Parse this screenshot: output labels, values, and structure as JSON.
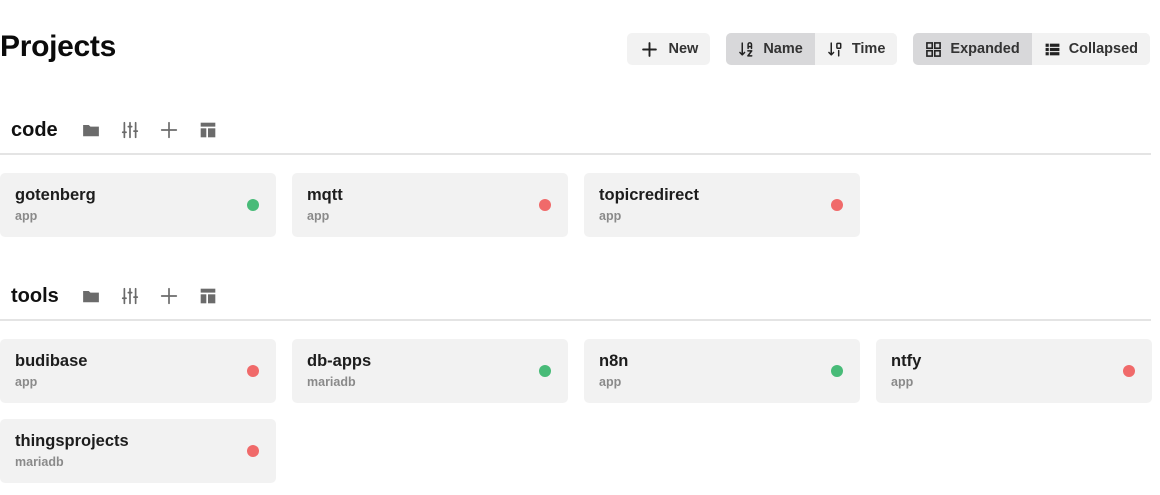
{
  "page": {
    "title": "Projects"
  },
  "toolbar": {
    "new_label": "New",
    "sort": [
      {
        "label": "Name",
        "icon": "sort-alpha-icon",
        "active": true
      },
      {
        "label": "Time",
        "icon": "sort-numeric-icon",
        "active": false
      }
    ],
    "view": [
      {
        "label": "Expanded",
        "icon": "grid-icon",
        "active": true
      },
      {
        "label": "Collapsed",
        "icon": "list-icon",
        "active": false
      }
    ]
  },
  "groups": [
    {
      "title": "code",
      "projects": [
        {
          "name": "gotenberg",
          "type": "app",
          "status": "up"
        },
        {
          "name": "mqtt",
          "type": "app",
          "status": "down"
        },
        {
          "name": "topicredirect",
          "type": "app",
          "status": "down"
        }
      ]
    },
    {
      "title": "tools",
      "projects": [
        {
          "name": "budibase",
          "type": "app",
          "status": "down"
        },
        {
          "name": "db-apps",
          "type": "mariadb",
          "status": "up"
        },
        {
          "name": "n8n",
          "type": "app",
          "status": "up"
        },
        {
          "name": "ntfy",
          "type": "app",
          "status": "down"
        },
        {
          "name": "thingsprojects",
          "type": "mariadb",
          "status": "down"
        }
      ]
    }
  ],
  "colors": {
    "status_up": "#48bb78",
    "status_down": "#f06a6a",
    "card_bg": "#f2f2f2",
    "active_toggle": "#d8d8da"
  }
}
